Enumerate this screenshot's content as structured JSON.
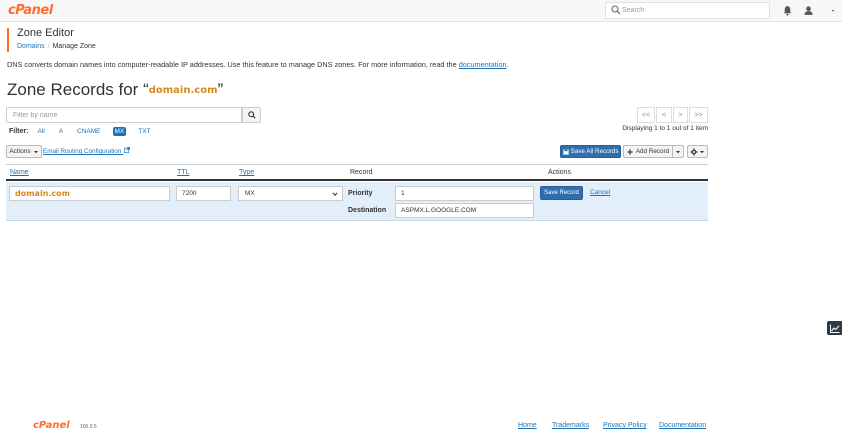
{
  "topbar": {
    "logo": "cPanel",
    "search_placeholder": "Search",
    "icons": [
      "search-icon",
      "bell-icon",
      "user-icon",
      "caret-down-icon"
    ]
  },
  "header": {
    "app_title": "Zone Editor",
    "breadcrumb": {
      "parent": "Domains",
      "separator": "/",
      "current": "Manage Zone"
    }
  },
  "description": {
    "text": "DNS converts domain names into computer-readable IP addresses. Use this feature to manage DNS zones. For more information, read the",
    "link": "documentation",
    "end": "."
  },
  "heading": {
    "prefix": "Zone Records for ",
    "open_quote": "“",
    "domain": "domain.com",
    "close_quote": "”"
  },
  "filter": {
    "placeholder": "Filter by name",
    "label": "Filter:",
    "types": [
      "All",
      "A",
      "CNAME",
      "MX",
      "TXT"
    ],
    "active": "MX"
  },
  "pagination": {
    "first": "<<",
    "prev": "<",
    "next": ">",
    "last": ">>",
    "status": "Displaying 1 to 1 out of 1 item"
  },
  "toolbar": {
    "actions_label": "Actions",
    "email_routing": "Email Routing Configuration",
    "save_all": "Save All Records",
    "add_record": "Add Record"
  },
  "table": {
    "columns": [
      "Name",
      "TTL",
      "Type",
      "Record",
      "Actions"
    ],
    "edit_row": {
      "name": "domain.com",
      "ttl": "7200",
      "type": "MX",
      "priority_label": "Priority",
      "priority": "1",
      "destination_label": "Destination",
      "destination": "ASPMX.L.GOOGLE.COM",
      "save": "Save Record",
      "cancel": "Cancel"
    }
  },
  "footer": {
    "logo": "cPanel",
    "version": "100.0.5",
    "links": [
      "Home",
      "Trademarks",
      "Privacy Policy",
      "Documentation"
    ]
  },
  "colors": {
    "brand": "#ff6c2c",
    "link": "#1a73b8",
    "primary": "#2f6fad",
    "row_highlight": "#e2eefa",
    "domain": "#d48a1c"
  }
}
